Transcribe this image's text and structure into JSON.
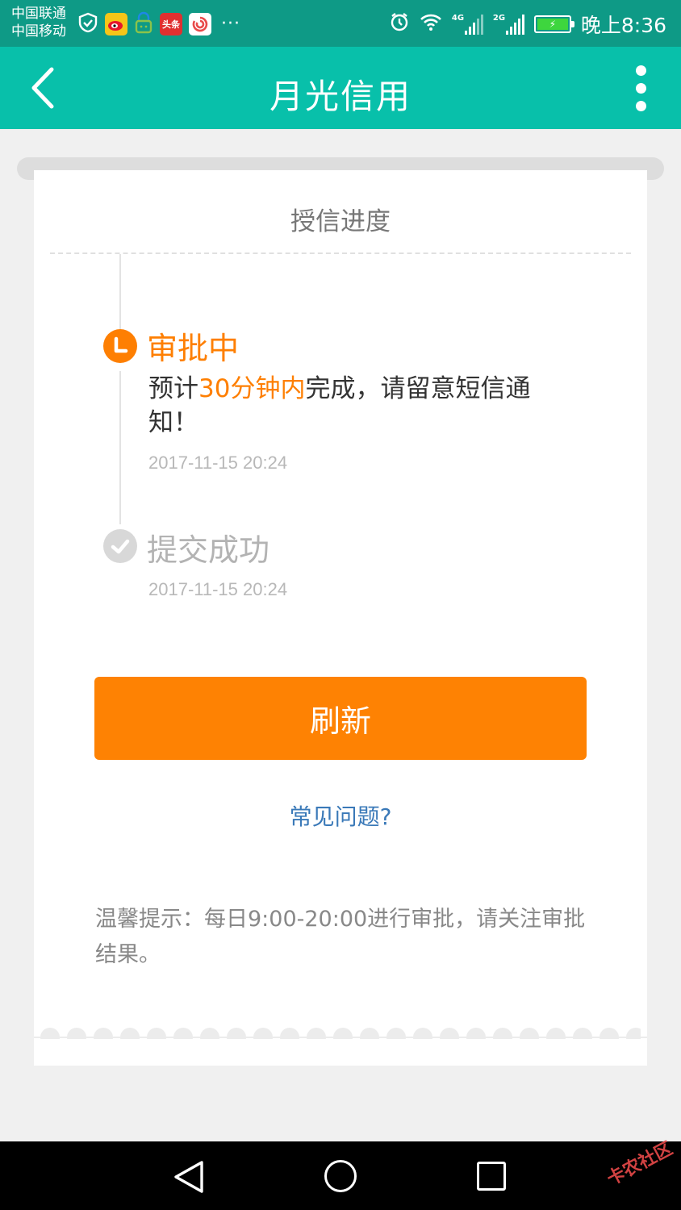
{
  "status_bar": {
    "carrier_1": "中国联通",
    "carrier_2": "中国移动",
    "app_icons": [
      "shield-icon",
      "weibo-icon",
      "lock-chat-icon",
      "toutiao-icon",
      "swirl-icon"
    ],
    "toutiao_label": "头条",
    "more": "···",
    "sim1_network": "4G",
    "sim2_network": "2G",
    "time": "晚上8:36"
  },
  "app_bar": {
    "title": "月光信用"
  },
  "card": {
    "title": "授信进度",
    "steps": [
      {
        "title": "审批中",
        "desc_before": "预计",
        "desc_highlight": "30分钟内",
        "desc_after": "完成，请留意短信通知！",
        "time": "2017-11-15 20:24",
        "status": "in-progress",
        "color": "#fe7f02"
      },
      {
        "title": "提交成功",
        "time": "2017-11-15 20:24",
        "status": "done",
        "color": "#d8d8d8"
      }
    ],
    "refresh_label": "刷新",
    "faq_label": "常见问题?",
    "tip": "温馨提示：每日9:00-20:00进行审批，请关注审批结果。"
  },
  "nav_bar": {
    "watermark": "卡农社区"
  },
  "colors": {
    "status_bar": "#0e9a86",
    "app_bar": "#08c0aa",
    "accent": "#fe7f02",
    "link": "#3a79b8"
  }
}
